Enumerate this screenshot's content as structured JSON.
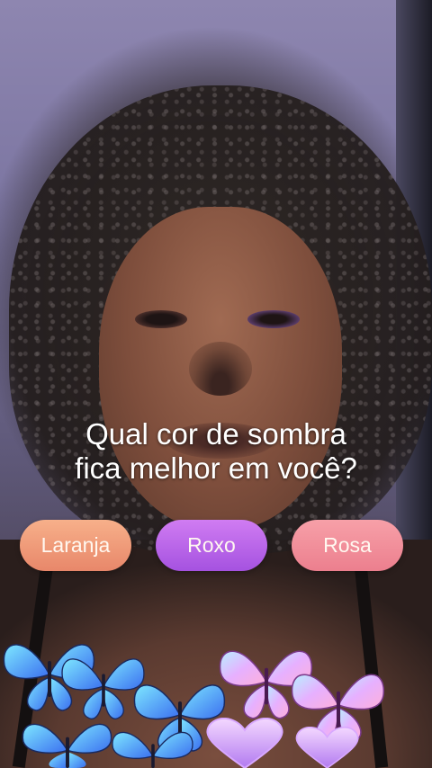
{
  "question": {
    "line1": "Qual cor de sombra",
    "line2": "fica melhor em você?"
  },
  "choices": [
    {
      "label": "Laranja",
      "color": "#f0a07e"
    },
    {
      "label": "Roxo",
      "color": "#be66ea"
    },
    {
      "label": "Rosa",
      "color": "#f290a0"
    }
  ],
  "decorations": {
    "left_icon": "blue-butterflies",
    "right_icon": "pink-butterflies",
    "bottom_icon": "lavender-hearts"
  }
}
